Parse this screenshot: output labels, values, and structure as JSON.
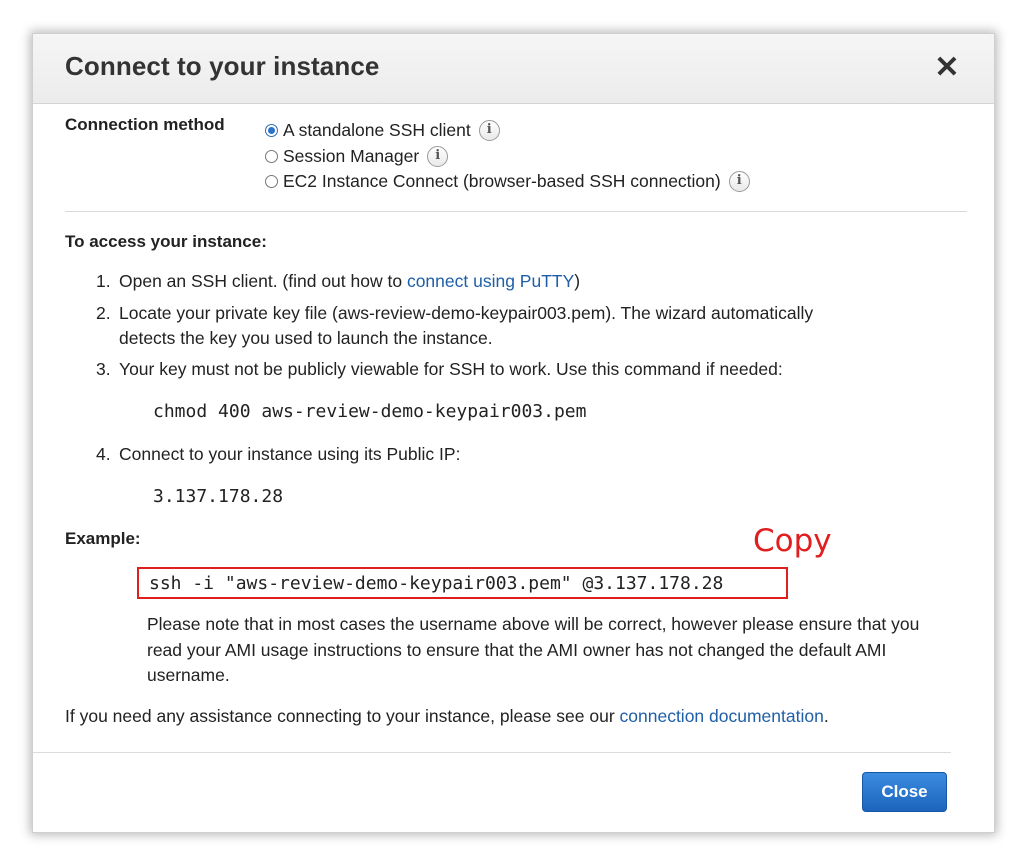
{
  "dialog": {
    "title": "Connect to your instance",
    "close_glyph": "✕"
  },
  "connection_method": {
    "label": "Connection method",
    "options": [
      {
        "label": "A standalone SSH client",
        "selected": true
      },
      {
        "label": "Session Manager",
        "selected": false
      },
      {
        "label": "EC2 Instance Connect (browser-based SSH connection)",
        "selected": false
      }
    ],
    "info_glyph": "i"
  },
  "access": {
    "title": "To access your instance:",
    "steps": [
      {
        "num": "1.",
        "text_before": "Open an SSH client. (find out how to ",
        "link": "connect using PuTTY",
        "text_after": ")"
      },
      {
        "num": "2.",
        "line1": "Locate your private key file (aws-review-demo-keypair003.pem). The wizard automatically",
        "line2": "detects the key you used to launch the instance."
      },
      {
        "num": "3.",
        "text": "Your key must not be publicly viewable for SSH to work. Use this command if needed:"
      },
      {
        "num": "4.",
        "text": "Connect to your instance using its Public IP:"
      }
    ],
    "chmod_command": "chmod 400 aws-review-demo-keypair003.pem",
    "public_ip": "3.137.178.28"
  },
  "example": {
    "title": "Example:",
    "copy_annotation": "Copy",
    "ssh_command": "ssh -i \"aws-review-demo-keypair003.pem\" @3.137.178.28",
    "note": "Please note that in most cases the username above will be correct, however please ensure that you read your AMI usage instructions to ensure that the AMI owner has not changed the default AMI username."
  },
  "assistance": {
    "text": "If you need any assistance connecting to your instance, please see our ",
    "link": "connection documentation",
    "end": "."
  },
  "footer": {
    "close_label": "Close"
  },
  "colors": {
    "link": "#1f5fa8",
    "annotation_red": "#e01e1e",
    "primary_button": "#1c64bd"
  }
}
